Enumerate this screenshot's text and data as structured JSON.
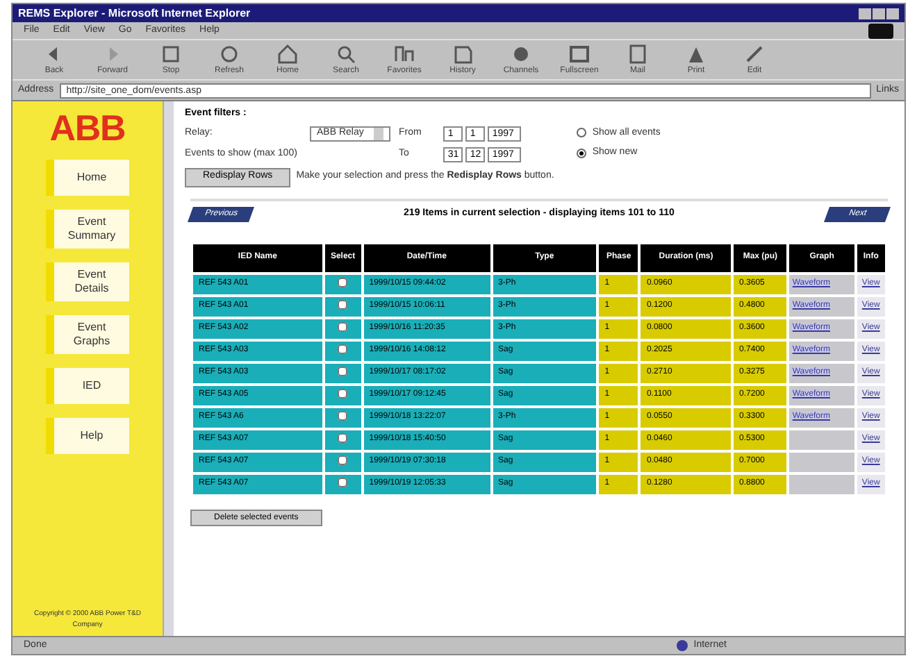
{
  "window": {
    "title": "REMS Explorer - Microsoft Internet Explorer"
  },
  "menu": [
    "File",
    "Edit",
    "View",
    "Go",
    "Favorites",
    "Help"
  ],
  "toolbar": [
    {
      "label": "Back",
      "kind": "back"
    },
    {
      "label": "Forward",
      "kind": "forward"
    },
    {
      "label": "Stop",
      "kind": "stop"
    },
    {
      "label": "Refresh",
      "kind": "refresh"
    },
    {
      "label": "Home",
      "kind": "home"
    },
    {
      "label": "Search",
      "kind": "search"
    },
    {
      "label": "Favorites",
      "kind": "favorites"
    },
    {
      "label": "History",
      "kind": "history"
    },
    {
      "label": "Channels",
      "kind": "channels"
    },
    {
      "label": "Fullscreen",
      "kind": "fullscreen"
    },
    {
      "label": "Mail",
      "kind": "mail"
    },
    {
      "label": "Print",
      "kind": "print"
    },
    {
      "label": "Edit",
      "kind": "edit"
    }
  ],
  "address": {
    "label": "Address",
    "value": "http://site_one_dom/events.asp",
    "go": "Links"
  },
  "sidebar": {
    "logo": "ABB",
    "items": [
      {
        "label": "Home"
      },
      {
        "label": "Event Summary"
      },
      {
        "label": "Event Details"
      },
      {
        "label": "Event Graphs"
      },
      {
        "label": "IED"
      },
      {
        "label": "Help"
      }
    ],
    "footer": "Copyright © 2000 ABB Power T&D Company"
  },
  "filters": {
    "title": "Event filters :",
    "relay_label": "Relay:",
    "relay_value": "ABB Relay",
    "from_label": "From",
    "from": [
      "1",
      "1",
      "1997"
    ],
    "events_label": "Events to show (max 100)",
    "to_label": "To",
    "to": [
      "31",
      "12",
      "1997"
    ],
    "radios": [
      {
        "label": "Show all events",
        "selected": false
      },
      {
        "label": "Show new",
        "selected": true
      }
    ],
    "button": "Redisplay Rows",
    "hint": "Make your selection and press the **Redisplay Rows** button."
  },
  "pager": {
    "previous": "Previous",
    "summary": "219 Items in current selection - displaying items 101 to 110",
    "next": "Next"
  },
  "table": {
    "columns": [
      "IED Name",
      "Select",
      "Date/Time",
      "Type",
      "Phase",
      "Duration (ms)",
      "Max (pu)",
      "Graph",
      "Info"
    ],
    "rows": [
      {
        "ied_name": "REF 543 A01",
        "checked": false,
        "date_time": "1999/10/15 09:44:02",
        "type": "3-Ph",
        "phase": "1",
        "duration": "0.0960",
        "max": "0.3605",
        "graph": "Waveform",
        "info": "View"
      },
      {
        "ied_name": "REF 543 A01",
        "checked": false,
        "date_time": "1999/10/15 10:06:11",
        "type": "3-Ph",
        "phase": "1",
        "duration": "0.1200",
        "max": "0.4800",
        "graph": "Waveform",
        "info": "View"
      },
      {
        "ied_name": "REF 543 A02",
        "checked": false,
        "date_time": "1999/10/16 11:20:35",
        "type": "3-Ph",
        "phase": "1",
        "duration": "0.0800",
        "max": "0.3600",
        "graph": "Waveform",
        "info": "View"
      },
      {
        "ied_name": "REF 543 A03",
        "checked": false,
        "date_time": "1999/10/16 14:08:12",
        "type": "Sag",
        "phase": "1",
        "duration": "0.2025",
        "max": "0.7400",
        "graph": "Waveform",
        "info": "View"
      },
      {
        "ied_name": "REF 543 A03",
        "checked": false,
        "date_time": "1999/10/17 08:17:02",
        "type": "Sag",
        "phase": "1",
        "duration": "0.2710",
        "max": "0.3275",
        "graph": "Waveform",
        "info": "View"
      },
      {
        "ied_name": "REF 543 A05",
        "checked": false,
        "date_time": "1999/10/17 09:12:45",
        "type": "Sag",
        "phase": "1",
        "duration": "0.1100",
        "max": "0.7200",
        "graph": "Waveform",
        "info": "View"
      },
      {
        "ied_name": "REF 543 A6",
        "checked": false,
        "date_time": "1999/10/18 13:22:07",
        "type": "3-Ph",
        "phase": "1",
        "duration": "0.0550",
        "max": "0.3300",
        "graph": "Waveform",
        "info": "View"
      },
      {
        "ied_name": "REF 543 A07",
        "checked": false,
        "date_time": "1999/10/18 15:40:50",
        "type": "Sag",
        "phase": "1",
        "duration": "0.0460",
        "max": "0.5300",
        "info": "View"
      },
      {
        "ied_name": "REF 543 A07",
        "checked": false,
        "date_time": "1999/10/19 07:30:18",
        "type": "Sag",
        "phase": "1",
        "duration": "0.0480",
        "max": "0.7000",
        "info": "View"
      },
      {
        "ied_name": "REF 543 A07",
        "checked": false,
        "date_time": "1999/10/19 12:05:33",
        "type": "Sag",
        "phase": "1",
        "duration": "0.1280",
        "max": "0.8800",
        "info": "View"
      }
    ]
  },
  "delete_button": "Delete selected events",
  "status_bar": {
    "left": "Done",
    "right": "Internet"
  }
}
